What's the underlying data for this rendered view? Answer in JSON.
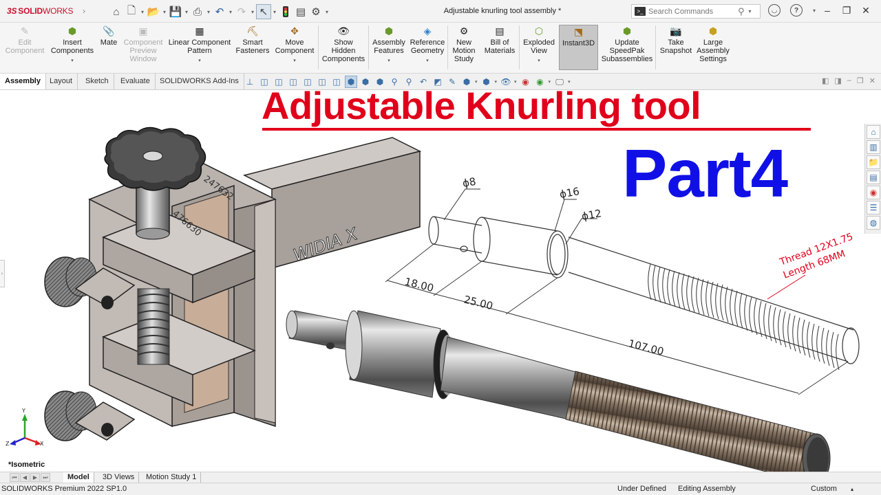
{
  "app": {
    "logo_ds": "3S",
    "logo_brand": "SOLID",
    "logo_works": "WORKS",
    "window_title": "Adjustable knurling tool assembly *"
  },
  "search": {
    "placeholder": "Search Commands"
  },
  "command_manager": {
    "edit_component": "Edit\nComponent",
    "insert_components": "Insert\nComponents",
    "mate": "Mate",
    "component_preview": "Component\nPreview\nWindow",
    "linear_pattern": "Linear Component\nPattern",
    "smart_fasteners": "Smart\nFasteners",
    "move_component": "Move\nComponent",
    "show_hidden": "Show\nHidden\nComponents",
    "assembly_features": "Assembly\nFeatures",
    "reference_geometry": "Reference\nGeometry",
    "new_motion_study": "New\nMotion\nStudy",
    "bill_of_materials": "Bill of\nMaterials",
    "exploded_view": "Exploded\nView",
    "instant3d": "Instant3D",
    "update_speedpak": "Update\nSpeedPak\nSubassemblies",
    "take_snapshot": "Take\nSnapshot",
    "large_assembly": "Large\nAssembly\nSettings"
  },
  "tabs": {
    "assembly": "Assembly",
    "layout": "Layout",
    "sketch": "Sketch",
    "evaluate": "Evaluate",
    "addins": "SOLIDWORKS Add-Ins"
  },
  "overlay": {
    "headline": "Adjustable Knurling tool",
    "part": "Part4",
    "stamp_1": "247632",
    "stamp_2": "476630",
    "brand_text": "WIDIA X"
  },
  "drawing": {
    "dia_8": "ϕ8",
    "dia_16": "ϕ16",
    "dia_12": "ϕ12",
    "dim_18": "18.00",
    "dim_25": "25.00",
    "dim_107": "107.00",
    "thread_line1": "Thread 12X1.75",
    "thread_line2": "Length 68MM"
  },
  "viewport": {
    "orientation": "*Isometric",
    "axis_x": "X",
    "axis_y": "Y",
    "axis_z": "Z"
  },
  "bottom_tabs": {
    "model": "Model",
    "views_3d": "3D Views",
    "motion_study": "Motion Study 1"
  },
  "status": {
    "product": "SOLIDWORKS Premium 2022 SP1.0",
    "definition": "Under Defined",
    "mode": "Editing Assembly",
    "units": "Custom"
  },
  "colors": {
    "headline": "#e1001b",
    "part": "#1010e6",
    "brand": "#c8102e"
  }
}
